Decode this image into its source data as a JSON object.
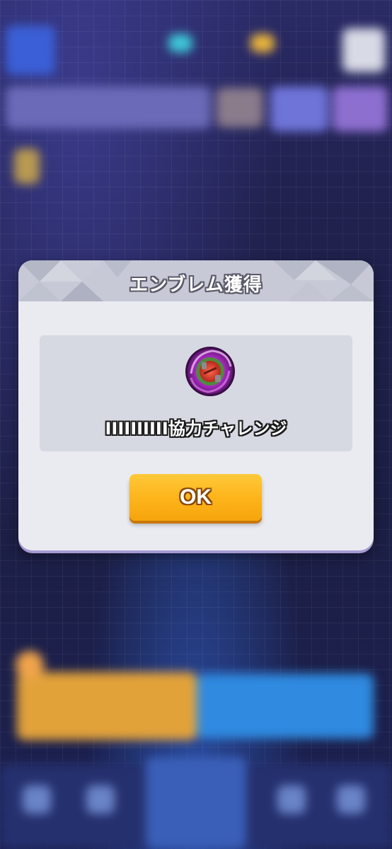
{
  "dialog": {
    "title": "エンブレム獲得",
    "reward_name": "IIIIIIIIII協力チャレンジ",
    "ok_label": "OK"
  },
  "emblem": {
    "icon": "purple-swirl-emblem-icon"
  },
  "colors": {
    "ok_button": "#fdb51b",
    "dialog_bg": "#e9ebf1",
    "panel_bg": "#d6d9e1",
    "backdrop": "#1d2146"
  }
}
